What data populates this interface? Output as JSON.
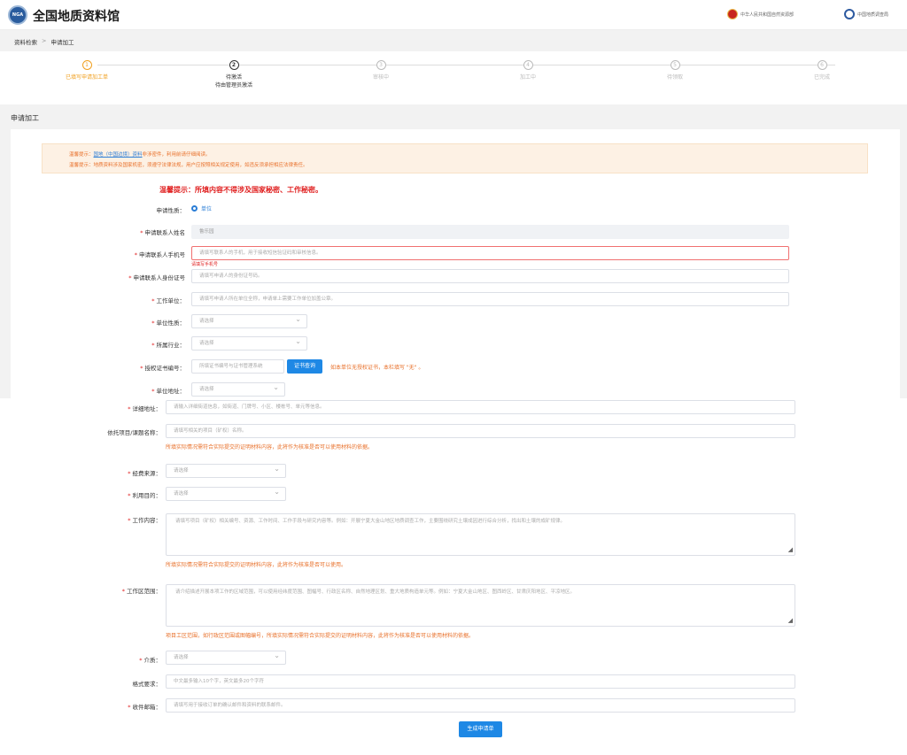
{
  "header": {
    "logo_text": "NGA",
    "title": "全国地质资料馆",
    "link1": "中华人民共和国自然资源部",
    "link2": "中国地质调查局"
  },
  "breadcrumb": {
    "item1": "资料检索",
    "sep": ">",
    "item2": "申请加工"
  },
  "steps": [
    {
      "num": "1",
      "label": "已填写申请加工单",
      "label2": ""
    },
    {
      "num": "2",
      "label": "待激活",
      "label2": "待由管理员激活"
    },
    {
      "num": "3",
      "label": "审核中",
      "label2": ""
    },
    {
      "num": "4",
      "label": "加工中",
      "label2": ""
    },
    {
      "num": "5",
      "label": "待领取",
      "label2": ""
    },
    {
      "num": "6",
      "label": "已完成",
      "label2": ""
    }
  ],
  "section_title": "申请加工",
  "notice": {
    "line1_prefix": "温馨提示：",
    "line1_link": "国地（中国边境）资料",
    "line1_suffix": "非涉密件，利用前请仔细阅读。",
    "line2": "温馨提示：地质资料涉及国家机密，须遵守法律法规，用户应按照相关规定使用，如违反须承担相应法律责任。"
  },
  "warning": "温馨提示：所填内容不得涉及国家秘密、工作秘密。",
  "form": {
    "applicant_type": {
      "label": "申请性质：",
      "option": "单位"
    },
    "contact_name": {
      "label": "申请联系人姓名",
      "value": "鲁乐园"
    },
    "contact_phone": {
      "label": "申请联系人手机号",
      "placeholder": "请填写联系人的手机，用于接收短信验证码和审核信息。",
      "error": "请填写手机号"
    },
    "contact_id": {
      "label": "申请联系人身份证号",
      "placeholder": "请填写申请人的身份证号码。"
    },
    "work_unit": {
      "label": "工作单位：",
      "placeholder": "请填写申请人所在单位全称，申请单上需要工作单位加盖公章。"
    },
    "unit_nature": {
      "label": "单位性质：",
      "placeholder": "请选择"
    },
    "industry": {
      "label": "所属行业：",
      "placeholder": "请选择"
    },
    "certificate": {
      "label": "授权证书编号：",
      "placeholder": "所填证书编号与证书管理系统",
      "button": "证书查询",
      "hint": "如本单位无授权证书，本栏填写 \"无\" 。"
    },
    "unit_address": {
      "label": "单位地址：",
      "placeholder": "请选择"
    },
    "detail_address": {
      "label": "详细地址：",
      "placeholder": "请输入详细街道信息，如街道、门牌号、小区、楼栋号、单元等信息。"
    },
    "project_name": {
      "label": "依托项目/课题名称：",
      "placeholder": "请填写相关的项目（矿权）名称。",
      "hint": "所填实际情况需符合实际提交的证明材料内容，此将作为核准是否可以使用材料的依据。"
    },
    "funding_source": {
      "label": "经费来源：",
      "placeholder": "请选择"
    },
    "purpose": {
      "label": "利用目的：",
      "placeholder": "请选择"
    },
    "work_content": {
      "label": "工作内容：",
      "placeholder": "请填写项目（矿权）相关编号、资源、工作时间、工作手段与研究内容等。例如：开展宁夏大金山地区地质调查工作，主要围绕研究土壤成因进行综合分析，找出和土壤的成矿规律。",
      "hint": "所填实际情况需符合实际提交的证明材料内容，此将作为核准是否可以使用。"
    },
    "work_area": {
      "label": "工作区范围：",
      "placeholder": "请介绍描述开展本项工作的区域范围，可以使用经纬度范围、图幅号、行政区名称、自然地理区划、重大地质构造单元等。例如：宁夏大金山地区、图西岭区、甘肃庆阳地区、平凉地区。",
      "hint": "项目工区范围，如行政区范围或图幅编号，所填实际情况需符合实际提交的证明材料内容，此将作为核准是否可以使用材料的依据。"
    },
    "medium": {
      "label": "介质：",
      "placeholder": "请选择"
    },
    "format": {
      "label": "格式要求：",
      "placeholder": "中文最多输入10个字，英文最多20个字符"
    },
    "email": {
      "label": "收件邮箱：",
      "placeholder": "请填写用于接收订单的确认邮件和资料的联系邮件。"
    },
    "submit": "生成申请单"
  },
  "colors": {
    "accent": "#1e88e5",
    "warning": "#e8702a",
    "error": "#e02020",
    "step_done": "#f0a020"
  }
}
